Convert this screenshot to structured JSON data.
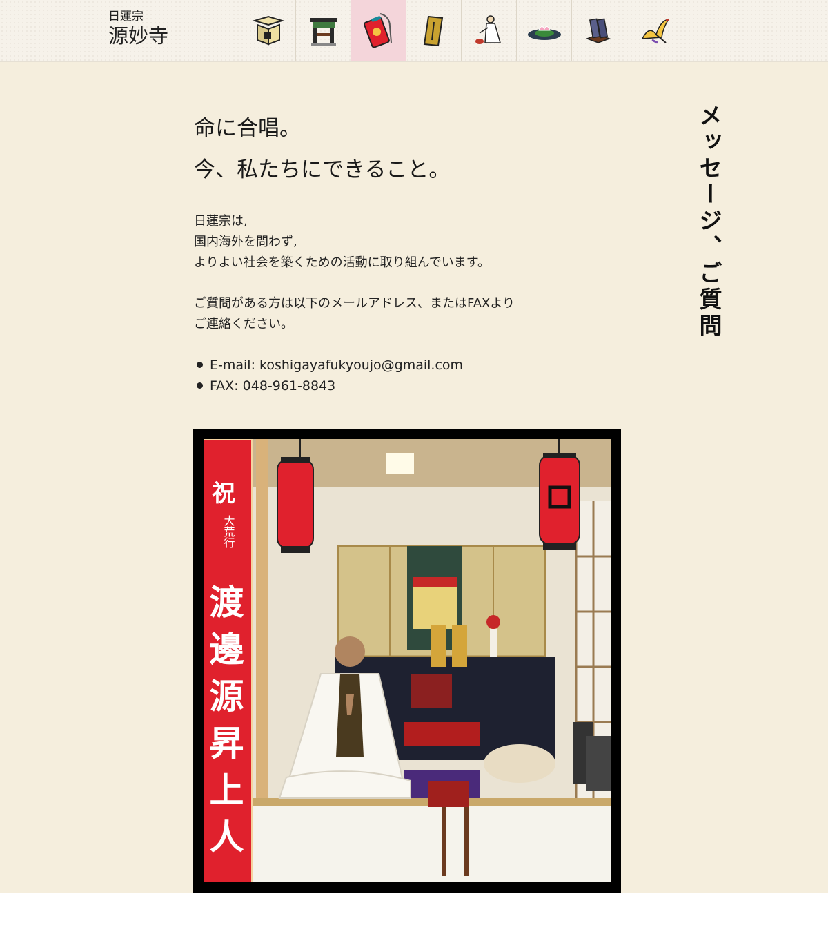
{
  "header": {
    "logo_sub": "日蓮宗",
    "logo_main": "源妙寺",
    "nav": [
      {
        "icon": "temple-box-icon",
        "active": false
      },
      {
        "icon": "gate-icon",
        "active": false
      },
      {
        "icon": "omamori-charm-icon",
        "active": true
      },
      {
        "icon": "wooden-tablet-icon",
        "active": false
      },
      {
        "icon": "monk-icon",
        "active": false
      },
      {
        "icon": "lotus-icon",
        "active": false
      },
      {
        "icon": "books-icon",
        "active": false
      },
      {
        "icon": "crane-icon",
        "active": false
      }
    ],
    "active_color": "#f4d5da"
  },
  "headline": {
    "line1": "命に合唱。",
    "line2": "今、私たちにできること。"
  },
  "intro": {
    "line1": "日蓮宗は,",
    "line2": "国内海外を問わず,",
    "line3": "よりよい社会を築くための活動に取り組んでいます。"
  },
  "contact_intro": {
    "line1": "ご質問がある方は以下のメールアドレス、またはFAXより",
    "line2": "ご連絡ください。"
  },
  "contacts": [
    {
      "text": "E-mail: koshigayafukyoujo@gmail.com"
    },
    {
      "text": "FAX: 048-961-8843"
    }
  ],
  "side_title": "メッセージ、ご質問",
  "photo": {
    "banner_top": "祝",
    "banner_small": "大荒行",
    "banner_name": "渡邊源昇上人"
  },
  "colors": {
    "page_bg": "#f5eedd",
    "header_bg": "#f6f2ea",
    "banner_red": "#e0212d"
  }
}
